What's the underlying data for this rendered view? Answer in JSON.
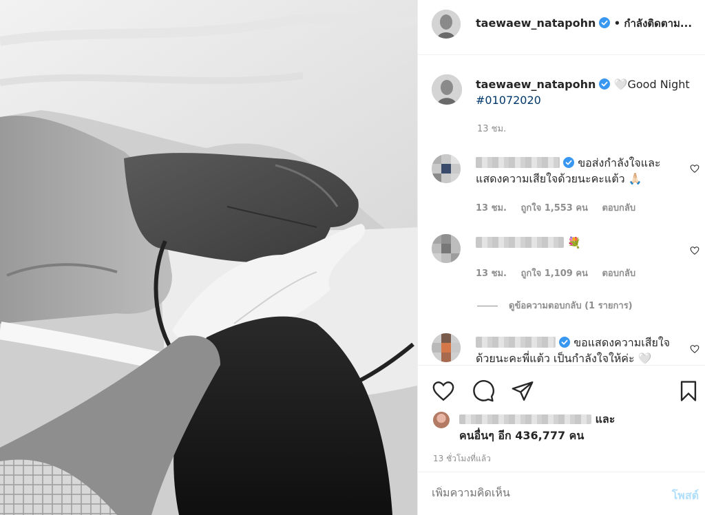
{
  "post": {
    "username": "taewaew_natapohn",
    "follow_status": "• กำลังติดตาม...",
    "caption_text": "🤍Good Night",
    "hashtag": "#01072020",
    "caption_time": "13 ชม."
  },
  "comments": [
    {
      "text": "ขอส่งกำลังใจและแสดงความเสียใจด้วยนะคะแต้ว 🙏🏻",
      "time": "13 ชม.",
      "likes": "ถูกใจ 1,553 คน",
      "reply": "ตอบกลับ"
    },
    {
      "text": "💐",
      "time": "13 ชม.",
      "likes": "ถูกใจ 1,109 คน",
      "reply": "ตอบกลับ",
      "view_replies": "ดูข้อความตอบกลับ (1 รายการ)"
    },
    {
      "text": "ขอแสดงความเสียใจด้วยนะคะพี่แต้ว เป็นกำลังใจให้ค่ะ 🤍"
    }
  ],
  "likes_summary": {
    "suffix": "และ",
    "line2": "คนอื่นๆ อีก 436,777 คน"
  },
  "timestamp": "13 ชั่วโมงที่แล้ว",
  "add_comment": {
    "placeholder": "เพิ่มความคิดเห็น",
    "post_label": "โพสต์"
  },
  "icons": {
    "like": "heart-icon",
    "comment": "comment-icon",
    "share": "paper-plane-icon",
    "save": "bookmark-icon",
    "verified": "verified-badge-icon"
  },
  "colors": {
    "verified": "#3897f0",
    "hashtag": "#00376b",
    "muted": "#8e8e8e",
    "post_button": "#b2dffc"
  }
}
